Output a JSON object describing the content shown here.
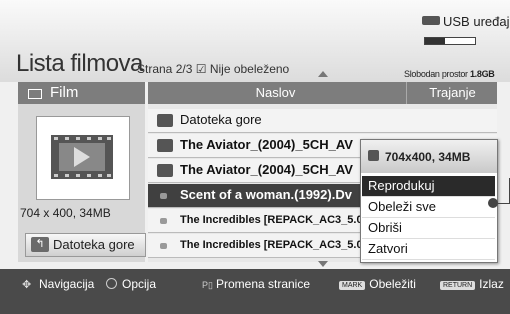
{
  "header": {
    "title": "Lista filmova",
    "page_info": "Strana 2/3",
    "mark_status": "Nije obeleženo",
    "usb_label": "USB uređaj",
    "free_space_label": "Slobodan prostor",
    "free_space_value": "1.8GB",
    "storage_used_fraction": 0.4
  },
  "left_panel": {
    "heading": "Film",
    "resolution": "704 x 400, 34MB",
    "parent_button": "Datoteka gore"
  },
  "list": {
    "columns": [
      "Naslov",
      "Trajanje"
    ],
    "rows": [
      {
        "label": "Datoteka gore",
        "type": "folder-up"
      },
      {
        "label": "The Aviator_(2004)_5CH_AV",
        "type": "folder"
      },
      {
        "label": "The Aviator_(2004)_5CH_AV",
        "type": "folder"
      },
      {
        "label": "Scent of a woman.(1992).Dv",
        "type": "file",
        "selected": true
      },
      {
        "label": "The Incredibles [REPACK_AC3_5.0",
        "type": "file"
      },
      {
        "label": "The Incredibles [REPACK_AC3_5.0",
        "type": "file"
      }
    ]
  },
  "popup": {
    "info": "704x400, 34MB",
    "items": [
      "Reprodukuj",
      "Obeleži sve",
      "Obriši",
      "Zatvori"
    ],
    "selected_index": 0
  },
  "footer": {
    "navigation": "Navigacija",
    "option": "Opcija",
    "page_change": "Promena stranice",
    "mark_key": "MARK",
    "mark": "Obeležiti",
    "return_key": "RETURN",
    "exit": "Izlaz"
  }
}
